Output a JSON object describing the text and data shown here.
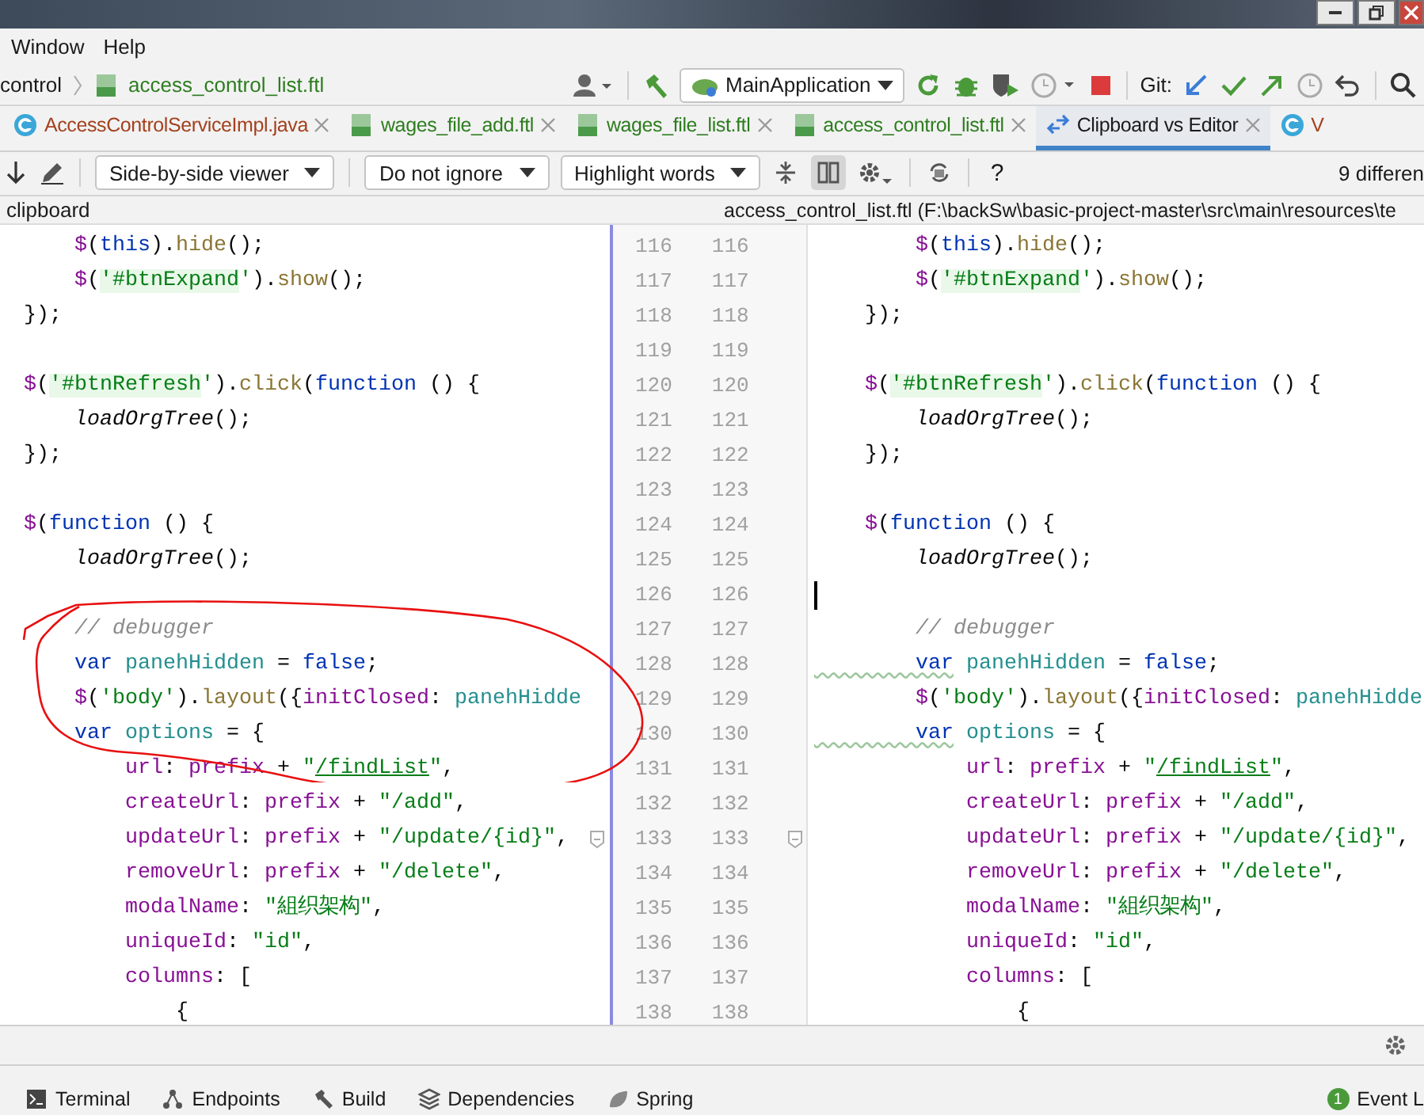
{
  "menu": [
    "Window",
    "Help"
  ],
  "breadcrumb": {
    "parent": "control",
    "file": "access_control_list.ftl"
  },
  "run_toolbar": {
    "config": "MainApplication",
    "git_label": "Git:"
  },
  "tabs": [
    {
      "label": "AccessControlServiceImpl.java",
      "kind": "java",
      "selected": false
    },
    {
      "label": "wages_file_add.ftl",
      "kind": "ftl",
      "selected": false
    },
    {
      "label": "wages_file_list.ftl",
      "kind": "ftl",
      "selected": false
    },
    {
      "label": "access_control_list.ftl",
      "kind": "ftl",
      "selected": false
    },
    {
      "label": "Clipboard vs Editor",
      "kind": "diff",
      "selected": true
    },
    {
      "label": "V",
      "kind": "java",
      "selected": false
    }
  ],
  "diff_toolbar": {
    "viewer": "Side-by-side viewer",
    "ignore": "Do not ignore",
    "highlight": "Highlight words",
    "sync_scroll_on": true,
    "help": "?",
    "differences": "9 differen"
  },
  "left": {
    "title": "clipboard",
    "lines": [
      {
        "number": "116",
        "tokens": [
          {
            "kind": "dollar",
            "text": "    $"
          },
          {
            "kind": "plain",
            "text": "("
          },
          {
            "kind": "kw",
            "text": "this"
          },
          {
            "kind": "plain",
            "text": ")."
          },
          {
            "kind": "method",
            "text": "hide"
          },
          {
            "kind": "plain",
            "text": "();"
          }
        ]
      },
      {
        "number": "117",
        "tokens": [
          {
            "kind": "dollar",
            "text": "    $"
          },
          {
            "kind": "plain",
            "text": "("
          },
          {
            "kind": "diffstr",
            "text": "'#btnExpand"
          },
          {
            "kind": "str",
            "text": "'"
          },
          {
            "kind": "plain",
            "text": ")."
          },
          {
            "kind": "method",
            "text": "show"
          },
          {
            "kind": "plain",
            "text": "();"
          }
        ]
      },
      {
        "number": "118",
        "tokens": [
          {
            "kind": "plain",
            "text": "});"
          }
        ]
      },
      {
        "number": "119"
      },
      {
        "number": "120",
        "tokens": [
          {
            "kind": "dollar",
            "text": "$"
          },
          {
            "kind": "plain",
            "text": "("
          },
          {
            "kind": "diffstr",
            "text": "'#btnRefresh"
          },
          {
            "kind": "str",
            "text": "'"
          },
          {
            "kind": "plain",
            "text": ")."
          },
          {
            "kind": "method",
            "text": "click"
          },
          {
            "kind": "plain",
            "text": "("
          },
          {
            "kind": "kw",
            "text": "function"
          },
          {
            "kind": "plain",
            "text": " () {"
          }
        ]
      },
      {
        "number": "121",
        "tokens": [
          {
            "kind": "call",
            "text": "    loadOrgTree"
          },
          {
            "kind": "plain",
            "text": "();"
          }
        ]
      },
      {
        "number": "122",
        "tokens": [
          {
            "kind": "plain",
            "text": "});"
          }
        ]
      },
      {
        "number": "123"
      },
      {
        "number": "124",
        "tokens": [
          {
            "kind": "dollar",
            "text": "$"
          },
          {
            "kind": "plain",
            "text": "("
          },
          {
            "kind": "kw",
            "text": "function"
          },
          {
            "kind": "plain",
            "text": " () {"
          }
        ]
      },
      {
        "number": "125",
        "tokens": [
          {
            "kind": "call",
            "text": "    loadOrgTree"
          },
          {
            "kind": "plain",
            "text": "();"
          }
        ]
      },
      {
        "number": "126"
      },
      {
        "number": "127",
        "tokens": [
          {
            "kind": "comment",
            "text": "    // debugger"
          }
        ]
      },
      {
        "number": "128",
        "tokens": [
          {
            "kind": "kw",
            "text": "    var"
          },
          {
            "kind": "local",
            "text": " panehHidden"
          },
          {
            "kind": "plain",
            "text": " = "
          },
          {
            "kind": "kw",
            "text": "false"
          },
          {
            "kind": "plain",
            "text": ";"
          }
        ]
      },
      {
        "number": "129",
        "tokens": [
          {
            "kind": "dollar",
            "text": "    $"
          },
          {
            "kind": "plain",
            "text": "("
          },
          {
            "kind": "str",
            "text": "'body'"
          },
          {
            "kind": "plain",
            "text": ")."
          },
          {
            "kind": "method",
            "text": "layout"
          },
          {
            "kind": "plain",
            "text": "({"
          },
          {
            "kind": "prop",
            "text": "initClosed"
          },
          {
            "kind": "plain",
            "text": ": "
          },
          {
            "kind": "local",
            "text": "panehHidde"
          }
        ]
      },
      {
        "number": "130",
        "tokens": [
          {
            "kind": "kw",
            "text": "    var"
          },
          {
            "kind": "local",
            "text": " options"
          },
          {
            "kind": "plain",
            "text": " = {"
          }
        ]
      },
      {
        "number": "131",
        "tokens": [
          {
            "kind": "prop",
            "text": "        url"
          },
          {
            "kind": "plain",
            "text": ": "
          },
          {
            "kind": "prop",
            "text": "prefix"
          },
          {
            "kind": "plain",
            "text": " + "
          },
          {
            "kind": "str",
            "text": "\""
          },
          {
            "kind": "link",
            "text": "/findList"
          },
          {
            "kind": "str",
            "text": "\""
          },
          {
            "kind": "plain",
            "text": ","
          }
        ]
      },
      {
        "number": "132",
        "tokens": [
          {
            "kind": "prop",
            "text": "        createUrl"
          },
          {
            "kind": "plain",
            "text": ": "
          },
          {
            "kind": "prop",
            "text": "prefix"
          },
          {
            "kind": "plain",
            "text": " + "
          },
          {
            "kind": "str",
            "text": "\"/add\""
          },
          {
            "kind": "plain",
            "text": ","
          }
        ]
      },
      {
        "number": "133",
        "tokens": [
          {
            "kind": "prop",
            "text": "        updateUrl"
          },
          {
            "kind": "plain",
            "text": ": "
          },
          {
            "kind": "prop",
            "text": "prefix"
          },
          {
            "kind": "plain",
            "text": " + "
          },
          {
            "kind": "str",
            "text": "\"/update/{id}\""
          },
          {
            "kind": "plain",
            "text": ","
          }
        ]
      },
      {
        "number": "134",
        "tokens": [
          {
            "kind": "prop",
            "text": "        removeUrl"
          },
          {
            "kind": "plain",
            "text": ": "
          },
          {
            "kind": "prop",
            "text": "prefix"
          },
          {
            "kind": "plain",
            "text": " + "
          },
          {
            "kind": "str",
            "text": "\"/delete\""
          },
          {
            "kind": "plain",
            "text": ","
          }
        ]
      },
      {
        "number": "135",
        "tokens": [
          {
            "kind": "prop",
            "text": "        modalName"
          },
          {
            "kind": "plain",
            "text": ": "
          },
          {
            "kind": "str",
            "text": "\"組织架构\""
          },
          {
            "kind": "plain",
            "text": ","
          }
        ]
      },
      {
        "number": "136",
        "tokens": [
          {
            "kind": "prop",
            "text": "        uniqueId"
          },
          {
            "kind": "plain",
            "text": ": "
          },
          {
            "kind": "str",
            "text": "\"id\""
          },
          {
            "kind": "plain",
            "text": ","
          }
        ]
      },
      {
        "number": "137",
        "tokens": [
          {
            "kind": "prop",
            "text": "        columns"
          },
          {
            "kind": "plain",
            "text": ": ["
          }
        ]
      },
      {
        "number": "138",
        "tokens": [
          {
            "kind": "plain",
            "text": "            {"
          }
        ]
      }
    ]
  },
  "right": {
    "title": "access_control_list.ftl",
    "path": "(F:\\backSw\\basic-project-master\\src\\main\\resources\\te",
    "lines": [
      {
        "number": "116",
        "tokens": [
          {
            "kind": "dollar",
            "text": "        $"
          },
          {
            "kind": "plain",
            "text": "("
          },
          {
            "kind": "kw",
            "text": "this"
          },
          {
            "kind": "plain",
            "text": ")."
          },
          {
            "kind": "method",
            "text": "hide"
          },
          {
            "kind": "plain",
            "text": "();"
          }
        ]
      },
      {
        "number": "117",
        "tokens": [
          {
            "kind": "dollar",
            "text": "        $"
          },
          {
            "kind": "plain",
            "text": "("
          },
          {
            "kind": "diffstr",
            "text": "'#btnExpand"
          },
          {
            "kind": "str",
            "text": "'"
          },
          {
            "kind": "plain",
            "text": ")."
          },
          {
            "kind": "method",
            "text": "show"
          },
          {
            "kind": "plain",
            "text": "();"
          }
        ]
      },
      {
        "number": "118",
        "tokens": [
          {
            "kind": "plain",
            "text": "    });"
          }
        ]
      },
      {
        "number": "119"
      },
      {
        "number": "120",
        "tokens": [
          {
            "kind": "dollar",
            "text": "    $"
          },
          {
            "kind": "plain",
            "text": "("
          },
          {
            "kind": "diffstr",
            "text": "'#btnRefresh"
          },
          {
            "kind": "str",
            "text": "'"
          },
          {
            "kind": "plain",
            "text": ")."
          },
          {
            "kind": "method",
            "text": "click"
          },
          {
            "kind": "plain",
            "text": "("
          },
          {
            "kind": "kw",
            "text": "function"
          },
          {
            "kind": "plain",
            "text": " () {"
          }
        ]
      },
      {
        "number": "121",
        "tokens": [
          {
            "kind": "call",
            "text": "        loadOrgTree"
          },
          {
            "kind": "plain",
            "text": "();"
          }
        ]
      },
      {
        "number": "122",
        "tokens": [
          {
            "kind": "plain",
            "text": "    });"
          }
        ]
      },
      {
        "number": "123"
      },
      {
        "number": "124",
        "tokens": [
          {
            "kind": "dollar",
            "text": "    $"
          },
          {
            "kind": "plain",
            "text": "("
          },
          {
            "kind": "kw",
            "text": "function"
          },
          {
            "kind": "plain",
            "text": " () {"
          }
        ]
      },
      {
        "number": "125",
        "tokens": [
          {
            "kind": "call",
            "text": "        loadOrgTree"
          },
          {
            "kind": "plain",
            "text": "();"
          }
        ]
      },
      {
        "number": "126",
        "cursor": true
      },
      {
        "number": "127",
        "tokens": [
          {
            "kind": "comment",
            "text": "        // debugger"
          }
        ]
      },
      {
        "number": "128",
        "tokens": [
          {
            "kind": "kwwarn",
            "text": "        var"
          },
          {
            "kind": "local",
            "text": " panehHidden"
          },
          {
            "kind": "plain",
            "text": " = "
          },
          {
            "kind": "kw",
            "text": "false"
          },
          {
            "kind": "plain",
            "text": ";"
          }
        ]
      },
      {
        "number": "129",
        "tokens": [
          {
            "kind": "dollar",
            "text": "        $"
          },
          {
            "kind": "plain",
            "text": "("
          },
          {
            "kind": "str",
            "text": "'body'"
          },
          {
            "kind": "plain",
            "text": ")."
          },
          {
            "kind": "method",
            "text": "layout"
          },
          {
            "kind": "plain",
            "text": "({"
          },
          {
            "kind": "prop",
            "text": "initClosed"
          },
          {
            "kind": "plain",
            "text": ": "
          },
          {
            "kind": "local",
            "text": "panehHidde"
          }
        ]
      },
      {
        "number": "130",
        "tokens": [
          {
            "kind": "kwwarn",
            "text": "        var"
          },
          {
            "kind": "local",
            "text": " options"
          },
          {
            "kind": "plain",
            "text": " = {"
          }
        ]
      },
      {
        "number": "131",
        "tokens": [
          {
            "kind": "prop",
            "text": "            url"
          },
          {
            "kind": "plain",
            "text": ": "
          },
          {
            "kind": "prop",
            "text": "prefix"
          },
          {
            "kind": "plain",
            "text": " + "
          },
          {
            "kind": "str",
            "text": "\""
          },
          {
            "kind": "link",
            "text": "/findList"
          },
          {
            "kind": "str",
            "text": "\""
          },
          {
            "kind": "plain",
            "text": ","
          }
        ]
      },
      {
        "number": "132",
        "tokens": [
          {
            "kind": "prop",
            "text": "            createUrl"
          },
          {
            "kind": "plain",
            "text": ": "
          },
          {
            "kind": "prop",
            "text": "prefix"
          },
          {
            "kind": "plain",
            "text": " + "
          },
          {
            "kind": "str",
            "text": "\"/add\""
          },
          {
            "kind": "plain",
            "text": ","
          }
        ]
      },
      {
        "number": "133",
        "tokens": [
          {
            "kind": "prop",
            "text": "            updateUrl"
          },
          {
            "kind": "plain",
            "text": ": "
          },
          {
            "kind": "prop",
            "text": "prefix"
          },
          {
            "kind": "plain",
            "text": " + "
          },
          {
            "kind": "str",
            "text": "\"/update/{id}\""
          },
          {
            "kind": "plain",
            "text": ","
          }
        ]
      },
      {
        "number": "134",
        "tokens": [
          {
            "kind": "prop",
            "text": "            removeUrl"
          },
          {
            "kind": "plain",
            "text": ": "
          },
          {
            "kind": "prop",
            "text": "prefix"
          },
          {
            "kind": "plain",
            "text": " + "
          },
          {
            "kind": "str",
            "text": "\"/delete\""
          },
          {
            "kind": "plain",
            "text": ","
          }
        ]
      },
      {
        "number": "135",
        "tokens": [
          {
            "kind": "prop",
            "text": "            modalName"
          },
          {
            "kind": "plain",
            "text": ": "
          },
          {
            "kind": "str",
            "text": "\"組织架构\""
          },
          {
            "kind": "plain",
            "text": ","
          }
        ]
      },
      {
        "number": "136",
        "tokens": [
          {
            "kind": "prop",
            "text": "            uniqueId"
          },
          {
            "kind": "plain",
            "text": ": "
          },
          {
            "kind": "str",
            "text": "\"id\""
          },
          {
            "kind": "plain",
            "text": ","
          }
        ]
      },
      {
        "number": "137",
        "tokens": [
          {
            "kind": "prop",
            "text": "            columns"
          },
          {
            "kind": "plain",
            "text": ": ["
          }
        ]
      },
      {
        "number": "138",
        "tokens": [
          {
            "kind": "plain",
            "text": "                {"
          }
        ]
      }
    ]
  },
  "tool_windows": [
    {
      "label": "Terminal",
      "kind": "terminal"
    },
    {
      "label": "Endpoints",
      "kind": "endpoints"
    },
    {
      "label": "Build",
      "kind": "build"
    },
    {
      "label": "Dependencies",
      "kind": "dependencies"
    },
    {
      "label": "Spring",
      "kind": "spring"
    }
  ],
  "event_log": {
    "count": "1",
    "label": "Event L"
  }
}
